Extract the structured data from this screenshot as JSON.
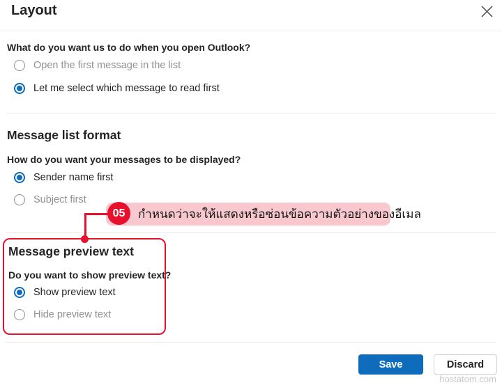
{
  "dialog": {
    "title": "Layout"
  },
  "sections": {
    "open_outlook": {
      "question": "What do you want us to do when you open Outlook?",
      "options": [
        {
          "label": "Open the first message in the list",
          "selected": false
        },
        {
          "label": "Let me select which message to read first",
          "selected": true
        }
      ]
    },
    "message_list_format": {
      "heading": "Message list format",
      "question": "How do you want your messages to be displayed?",
      "options": [
        {
          "label": "Sender name first",
          "selected": true
        },
        {
          "label": "Subject first",
          "selected": false
        }
      ]
    },
    "message_preview_text": {
      "heading": "Message preview text",
      "question": "Do you want to show preview text?",
      "options": [
        {
          "label": "Show preview text",
          "selected": true
        },
        {
          "label": "Hide preview text",
          "selected": false
        }
      ]
    }
  },
  "annotation": {
    "step_number": "05",
    "text": "กำหนดว่าจะให้แสดงหรือซ่อนข้อความตัวอย่างของอีเมล",
    "badge_color": "#e8112d",
    "bubble_color": "#f8c8ce",
    "highlight_border_color": "#e8112d"
  },
  "footer": {
    "save_label": "Save",
    "discard_label": "Discard"
  },
  "watermark": "hostatom.com",
  "colors": {
    "accent_blue": "#0f6cbd",
    "text_primary": "#242424",
    "text_muted": "#919191",
    "divider": "#e8e8e8"
  }
}
